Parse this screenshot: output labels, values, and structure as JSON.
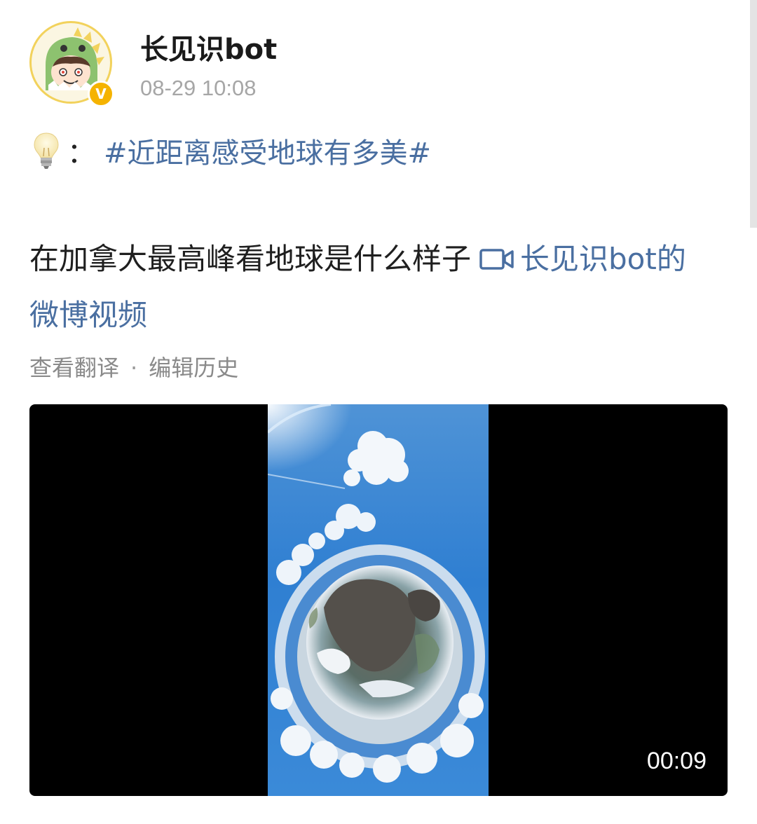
{
  "post": {
    "author": {
      "name": "长见识bot",
      "verified_badge": "V",
      "avatar_icon": "dinosaur-avatar-icon"
    },
    "timestamp": "08-29 10:08",
    "topic": {
      "emoji_icon": "light-bulb-icon",
      "separator": "：",
      "hashtag": "#近距离感受地球有多美#"
    },
    "text": "在加拿大最高峰看地球是什么样子",
    "video_link": {
      "icon": "video-camera-icon",
      "label": "长见识bot的微博视频"
    },
    "actions": {
      "translate_label": "查看翻译",
      "separator": "·",
      "edit_history_label": "编辑历史"
    },
    "video": {
      "duration": "00:09"
    }
  },
  "colors": {
    "link_blue": "#4a6fa1",
    "timestamp_gray": "#a6a6a6",
    "badge_gold": "#f5b300"
  }
}
